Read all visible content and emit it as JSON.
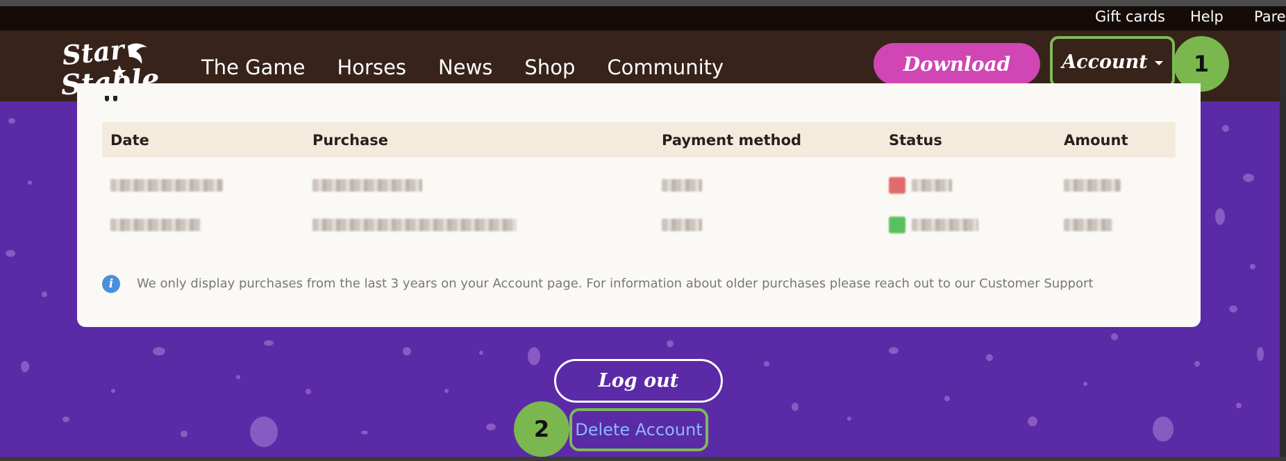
{
  "utility_links": [
    "Gift cards",
    "Help",
    "Pare"
  ],
  "logo_alt": "Star Stable",
  "nav": {
    "items": [
      "The Game",
      "Horses",
      "News",
      "Shop",
      "Community"
    ],
    "download_label": "Download",
    "account_label": "Account"
  },
  "annotations": {
    "step1": "1",
    "step2": "2"
  },
  "purchases": {
    "columns": [
      "Date",
      "Purchase",
      "Payment method",
      "Status",
      "Amount"
    ],
    "rows": [
      {
        "status_color": "#e06b6b"
      },
      {
        "status_color": "#59c062"
      }
    ],
    "info_text": "We only display purchases from the last 3 years on your Account page. For information about older purchases please reach out to our Customer Support"
  },
  "actions": {
    "logout_label": "Log out",
    "delete_label": "Delete Account"
  },
  "colors": {
    "background": "#5b2aa6",
    "nav_bg": "#37231a",
    "download": "#cf46b4",
    "annotation_green": "#7ab84f",
    "delete_link": "#8bb8ff"
  }
}
